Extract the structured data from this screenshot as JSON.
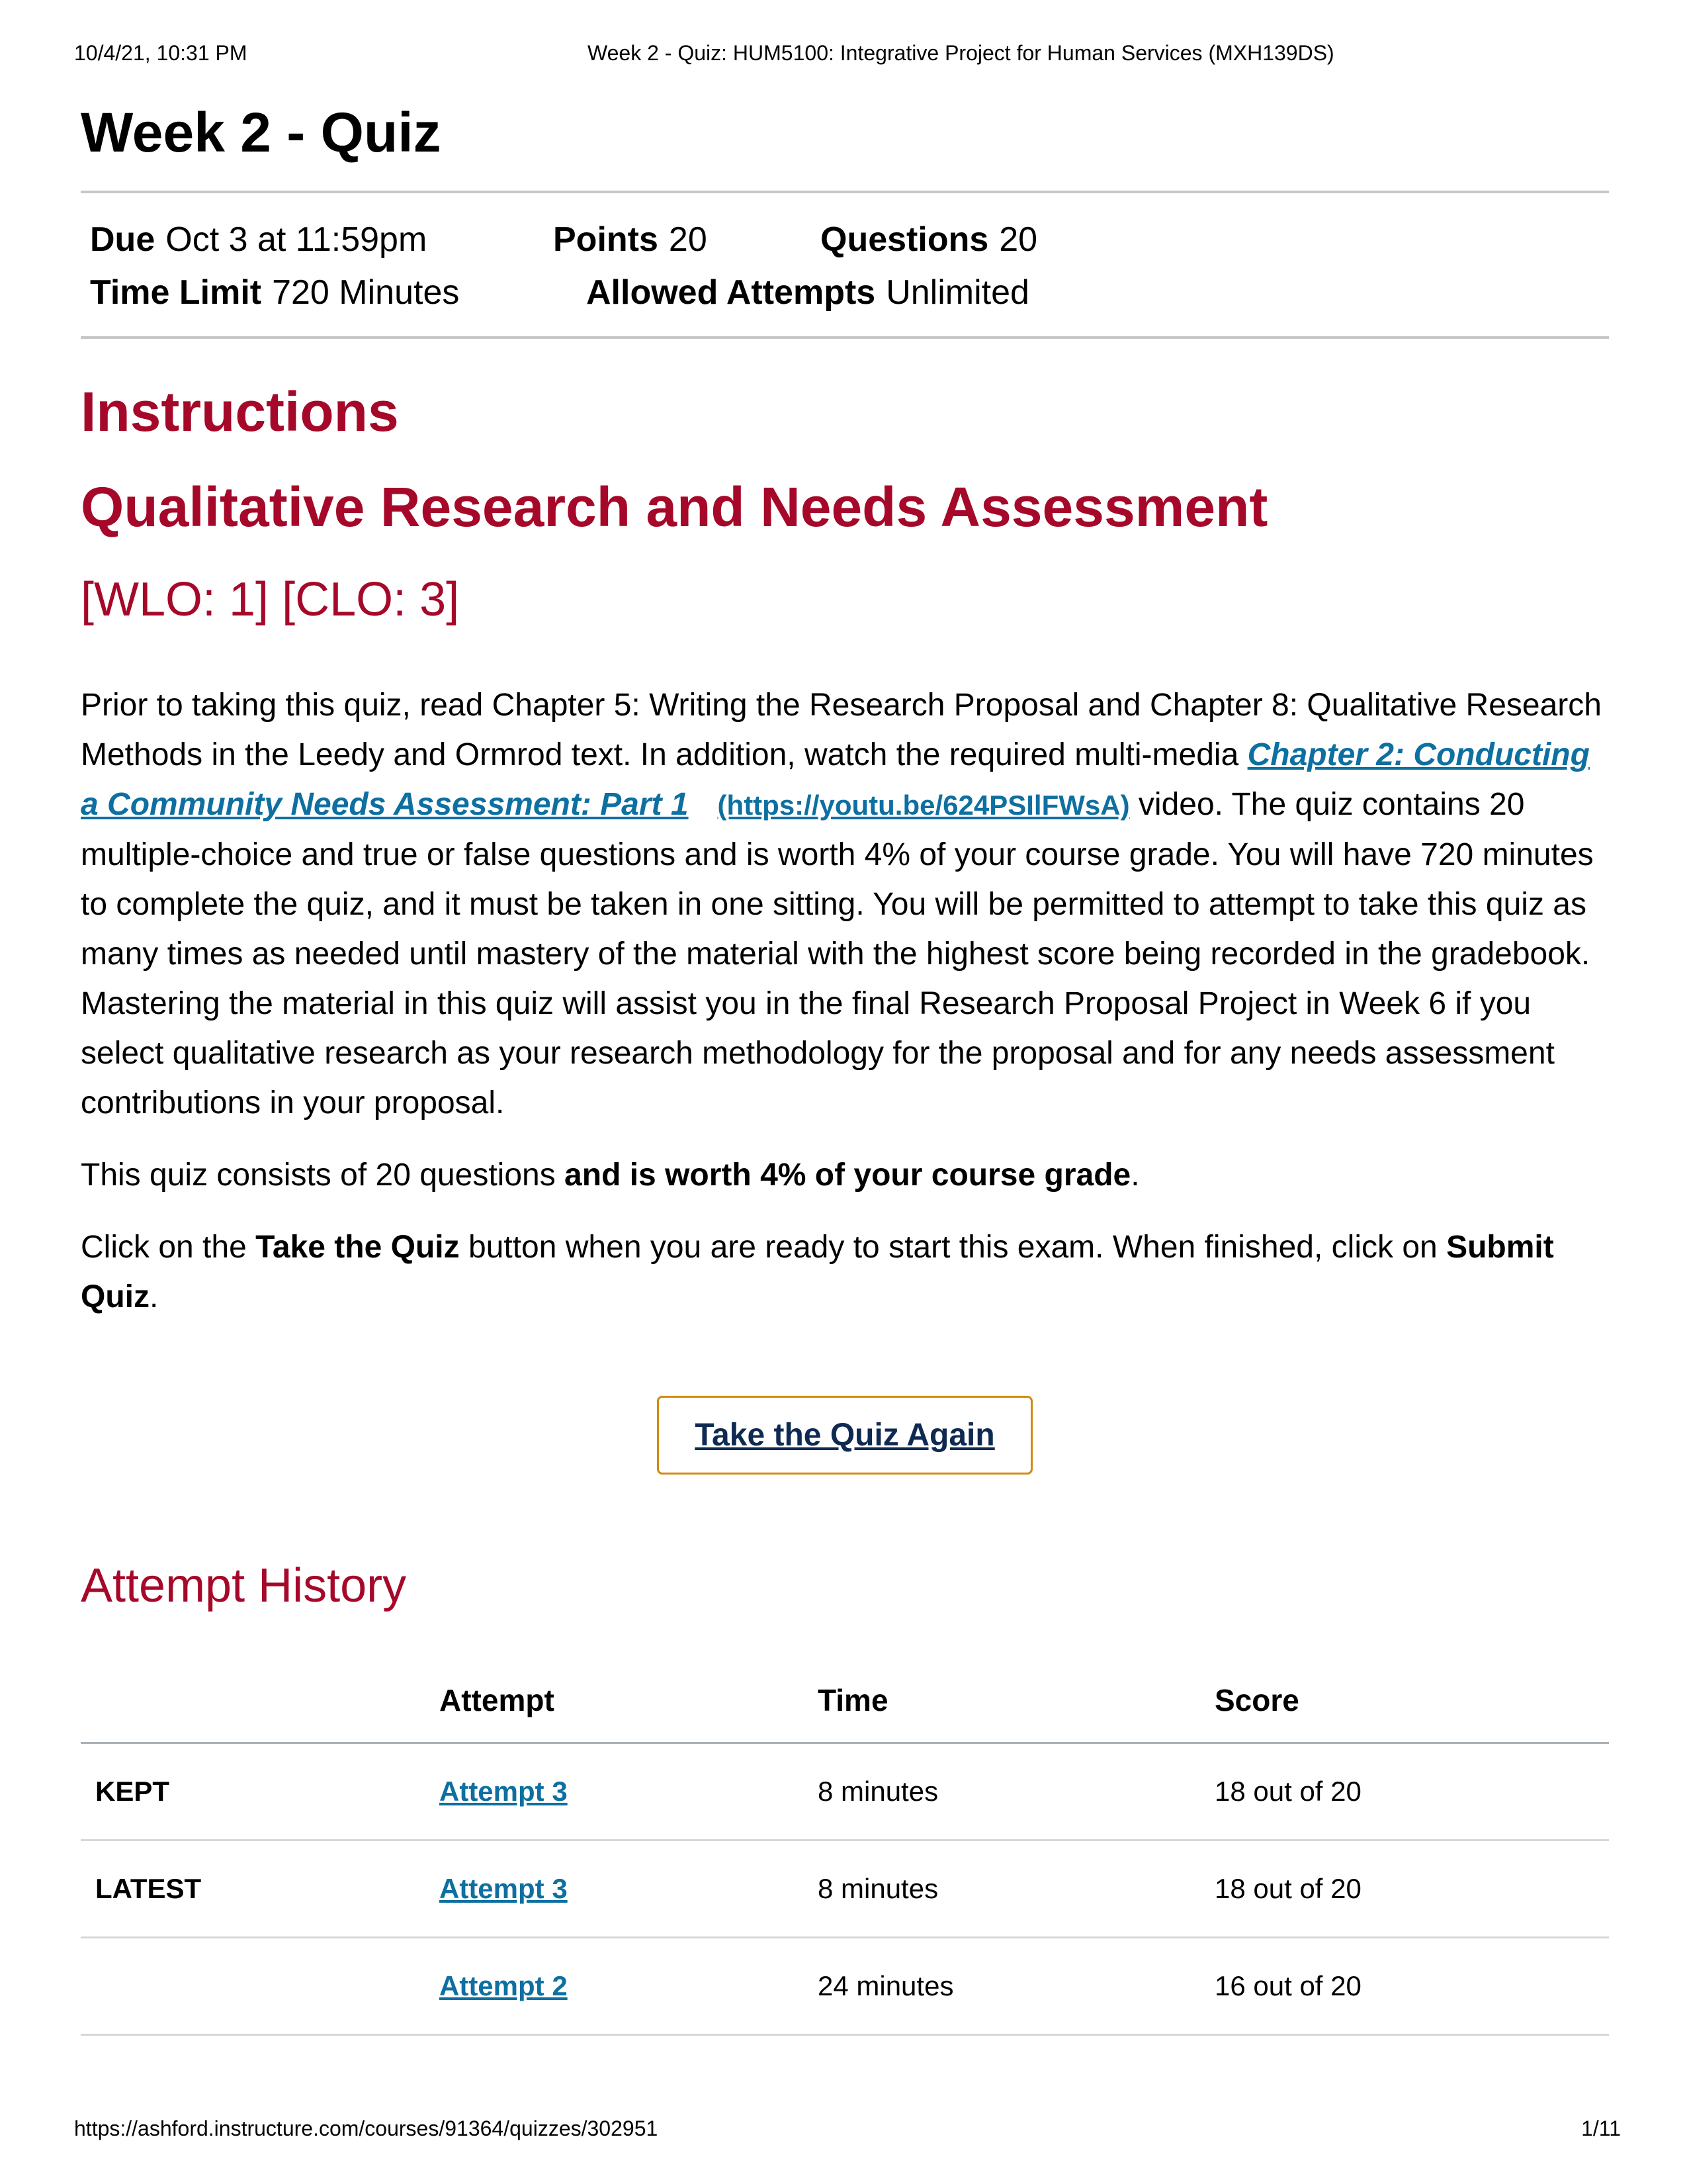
{
  "print_header": {
    "datetime": "10/4/21, 10:31 PM",
    "document_title": "Week 2 - Quiz: HUM5100: Integrative Project for Human Services (MXH139DS)"
  },
  "page_title": "Week 2 - Quiz",
  "quiz_meta": {
    "due_label": "Due",
    "due_value": "Oct 3 at 11:59pm",
    "points_label": "Points",
    "points_value": "20",
    "questions_label": "Questions",
    "questions_value": "20",
    "time_limit_label": "Time Limit",
    "time_limit_value": "720 Minutes",
    "allowed_attempts_label": "Allowed Attempts",
    "allowed_attempts_value": "Unlimited"
  },
  "instructions": {
    "heading": "Instructions",
    "subheading": "Qualitative Research and Needs Assessment",
    "objectives": "[WLO: 1] [CLO: 3]",
    "paragraph1_part1": "Prior to taking this quiz, read Chapter 5: Writing the Research Proposal and Chapter 8: Qualitative Research Methods in the Leedy and Ormrod text. In addition, watch the required multi-media ",
    "video_link_text": "Chapter 2: Conducting a Community Needs Assessment: Part 1",
    "video_link_url_text": "(https://youtu.be/624PSIlFWsA)",
    "paragraph1_part2": " video. The quiz contains 20 multiple-choice and true or false questions and is worth 4% of your course grade. You will have 720 minutes to complete the quiz, and it must be taken in one sitting. You will be permitted to attempt to take this quiz as many times as needed until mastery of the material with the highest score being recorded in the gradebook. Mastering the material in this quiz will assist you in the final Research Proposal Project in Week 6 if you select qualitative research as your research methodology for the proposal and for any needs assessment contributions in your proposal.",
    "paragraph2_plain": "This quiz consists of 20 questions ",
    "paragraph2_bold": "and is worth 4% of your course grade",
    "paragraph2_end": ".",
    "paragraph3_a": "Click on the ",
    "paragraph3_bold1": "Take the Quiz",
    "paragraph3_b": " button when you are ready to start this exam. When finished, click on ",
    "paragraph3_bold2": "Submit Quiz",
    "paragraph3_end": "."
  },
  "take_quiz_button": "Take the Quiz Again",
  "attempt_history": {
    "heading": "Attempt History",
    "columns": [
      "",
      "Attempt",
      "Time",
      "Score"
    ],
    "rows": [
      {
        "status": "KEPT",
        "attempt": "Attempt 3",
        "time": "8 minutes",
        "score": "18 out of 20"
      },
      {
        "status": "LATEST",
        "attempt": "Attempt 3",
        "time": "8 minutes",
        "score": "18 out of 20"
      },
      {
        "status": "",
        "attempt": "Attempt 2",
        "time": "24 minutes",
        "score": "16 out of 20"
      }
    ]
  },
  "print_footer": {
    "url": "https://ashford.instructure.com/courses/91364/quizzes/302951",
    "page": "1/11"
  },
  "colors": {
    "heading_red": "#a6082a",
    "link_blue": "#0e6fa1",
    "button_border": "#d08a10",
    "button_text": "#0f2a52"
  }
}
